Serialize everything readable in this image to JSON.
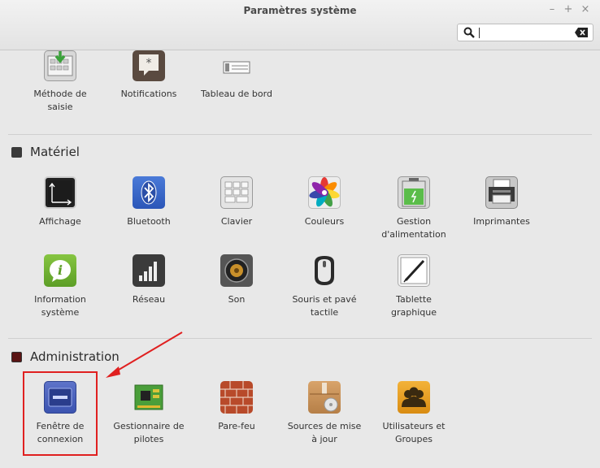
{
  "window": {
    "title": "Paramètres système",
    "minimize": "–",
    "maximize": "+",
    "close": "×"
  },
  "search": {
    "value": "",
    "placeholder": ""
  },
  "sections": {
    "personal_tail": {
      "items": [
        {
          "label": "Méthode de\nsaisie",
          "icon": "keyboard-arrow-icon"
        },
        {
          "label": "Notifications",
          "icon": "notification-icon"
        },
        {
          "label": "Tableau de bord",
          "icon": "panel-icon"
        }
      ]
    },
    "materiel": {
      "title": "Matériel",
      "items": [
        {
          "label": "Affichage",
          "icon": "display-icon"
        },
        {
          "label": "Bluetooth",
          "icon": "bluetooth-icon"
        },
        {
          "label": "Clavier",
          "icon": "keyboard-icon"
        },
        {
          "label": "Couleurs",
          "icon": "color-wheel-icon"
        },
        {
          "label": "Gestion\nd'alimentation",
          "icon": "battery-icon"
        },
        {
          "label": "Imprimantes",
          "icon": "printer-icon"
        },
        {
          "label": "Information\nsystème",
          "icon": "info-icon"
        },
        {
          "label": "Réseau",
          "icon": "network-bars-icon"
        },
        {
          "label": "Son",
          "icon": "speaker-icon"
        },
        {
          "label": "Souris et pavé\ntactile",
          "icon": "mouse-icon"
        },
        {
          "label": "Tablette\ngraphique",
          "icon": "tablet-icon"
        }
      ]
    },
    "administration": {
      "title": "Administration",
      "items": [
        {
          "label": "Fenêtre de\nconnexion",
          "icon": "login-window-icon"
        },
        {
          "label": "Gestionnaire de\npilotes",
          "icon": "driver-board-icon"
        },
        {
          "label": "Pare-feu",
          "icon": "firewall-icon"
        },
        {
          "label": "Sources de mise\nà jour",
          "icon": "package-icon"
        },
        {
          "label": "Utilisateurs et\nGroupes",
          "icon": "users-icon"
        }
      ]
    }
  },
  "colors": {
    "highlight": "#e02020",
    "background": "#e8e8e8"
  }
}
